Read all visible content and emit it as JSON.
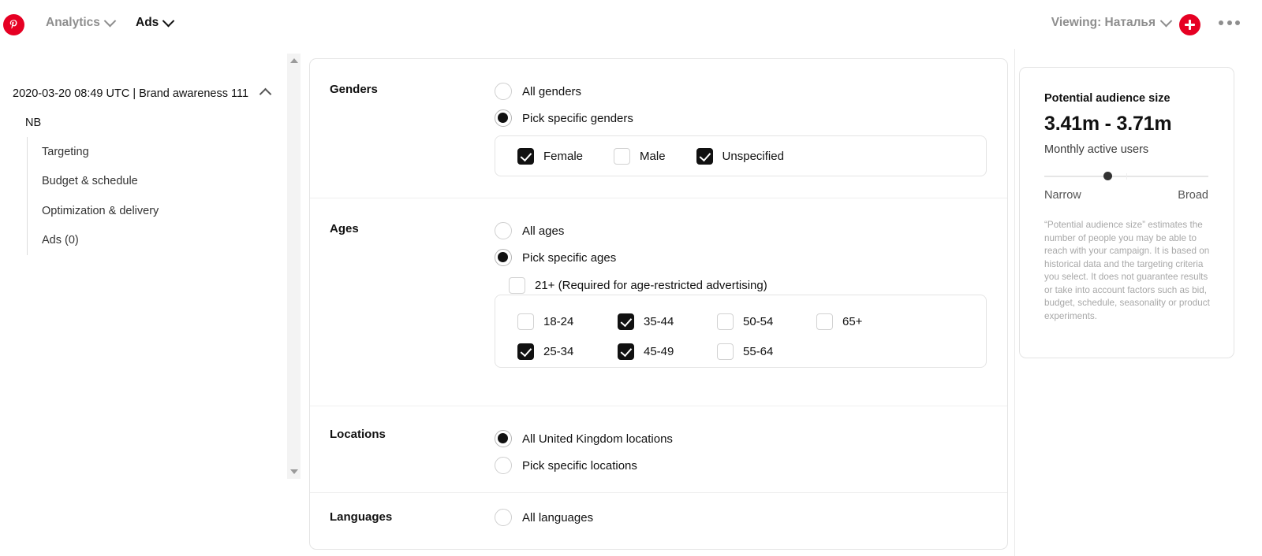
{
  "header": {
    "logo_icon": "pinterest-logo-icon",
    "nav": [
      {
        "label": "Analytics",
        "icon": "chevron-down-icon"
      },
      {
        "label": "Ads",
        "icon": "chevron-down-icon"
      }
    ],
    "viewing_label": "Viewing: Наталья",
    "viewing_icon": "chevron-down-icon",
    "plus_icon": "plus-icon",
    "more_icon": "more-horizontal-icon"
  },
  "sidebar": {
    "campaign_title": "2020-03-20 08:49 UTC | Brand awareness 111",
    "collapse_icon": "chevron-up-icon",
    "group_label": "NB",
    "items": [
      {
        "label": "Targeting"
      },
      {
        "label": "Budget & schedule"
      },
      {
        "label": "Optimization & delivery"
      },
      {
        "label": "Ads (0)"
      }
    ],
    "scrollbar": {
      "up_icon": "scroll-up-arrow-icon",
      "down_icon": "scroll-down-arrow-icon"
    }
  },
  "main": {
    "genders": {
      "title": "Genders",
      "radios": [
        {
          "label": "All genders",
          "selected": false
        },
        {
          "label": "Pick specific genders",
          "selected": true
        }
      ],
      "checkboxes": [
        {
          "label": "Female",
          "checked": true
        },
        {
          "label": "Male",
          "checked": false
        },
        {
          "label": "Unspecified",
          "checked": true
        }
      ]
    },
    "ages": {
      "title": "Ages",
      "radios": [
        {
          "label": "All ages",
          "selected": false
        },
        {
          "label": "Pick specific ages",
          "selected": true
        }
      ],
      "age_restricted": {
        "label": "21+ (Required for age-restricted advertising)",
        "checked": false
      },
      "brackets": [
        {
          "label": "18-24",
          "checked": false
        },
        {
          "label": "35-44",
          "checked": true
        },
        {
          "label": "50-54",
          "checked": false
        },
        {
          "label": "65+",
          "checked": false
        },
        {
          "label": "25-34",
          "checked": true
        },
        {
          "label": "45-49",
          "checked": true
        },
        {
          "label": "55-64",
          "checked": false
        }
      ]
    },
    "locations": {
      "title": "Locations",
      "radios": [
        {
          "label": "All United Kingdom locations",
          "selected": true
        },
        {
          "label": "Pick specific locations",
          "selected": false
        }
      ]
    },
    "languages": {
      "title": "Languages",
      "radios": [
        {
          "label": "All languages",
          "selected": false
        }
      ]
    }
  },
  "audience_panel": {
    "title": "Potential audience size",
    "value": "3.41m - 3.71m",
    "subtitle": "Monthly active users",
    "scale_min_label": "Narrow",
    "scale_max_label": "Broad",
    "note": "“Potential audience size” estimates the number of people you may be able to reach with your campaign. It is based on historical data and the targeting criteria you select. It does not guarantee results or take into account factors such as bid, budget, schedule, seasonality or product experiments."
  },
  "colors": {
    "brand_red": "#e60023",
    "selected_dark": "#111111",
    "border_light": "#e4e4e4",
    "muted_text": "#8e8e8e"
  }
}
